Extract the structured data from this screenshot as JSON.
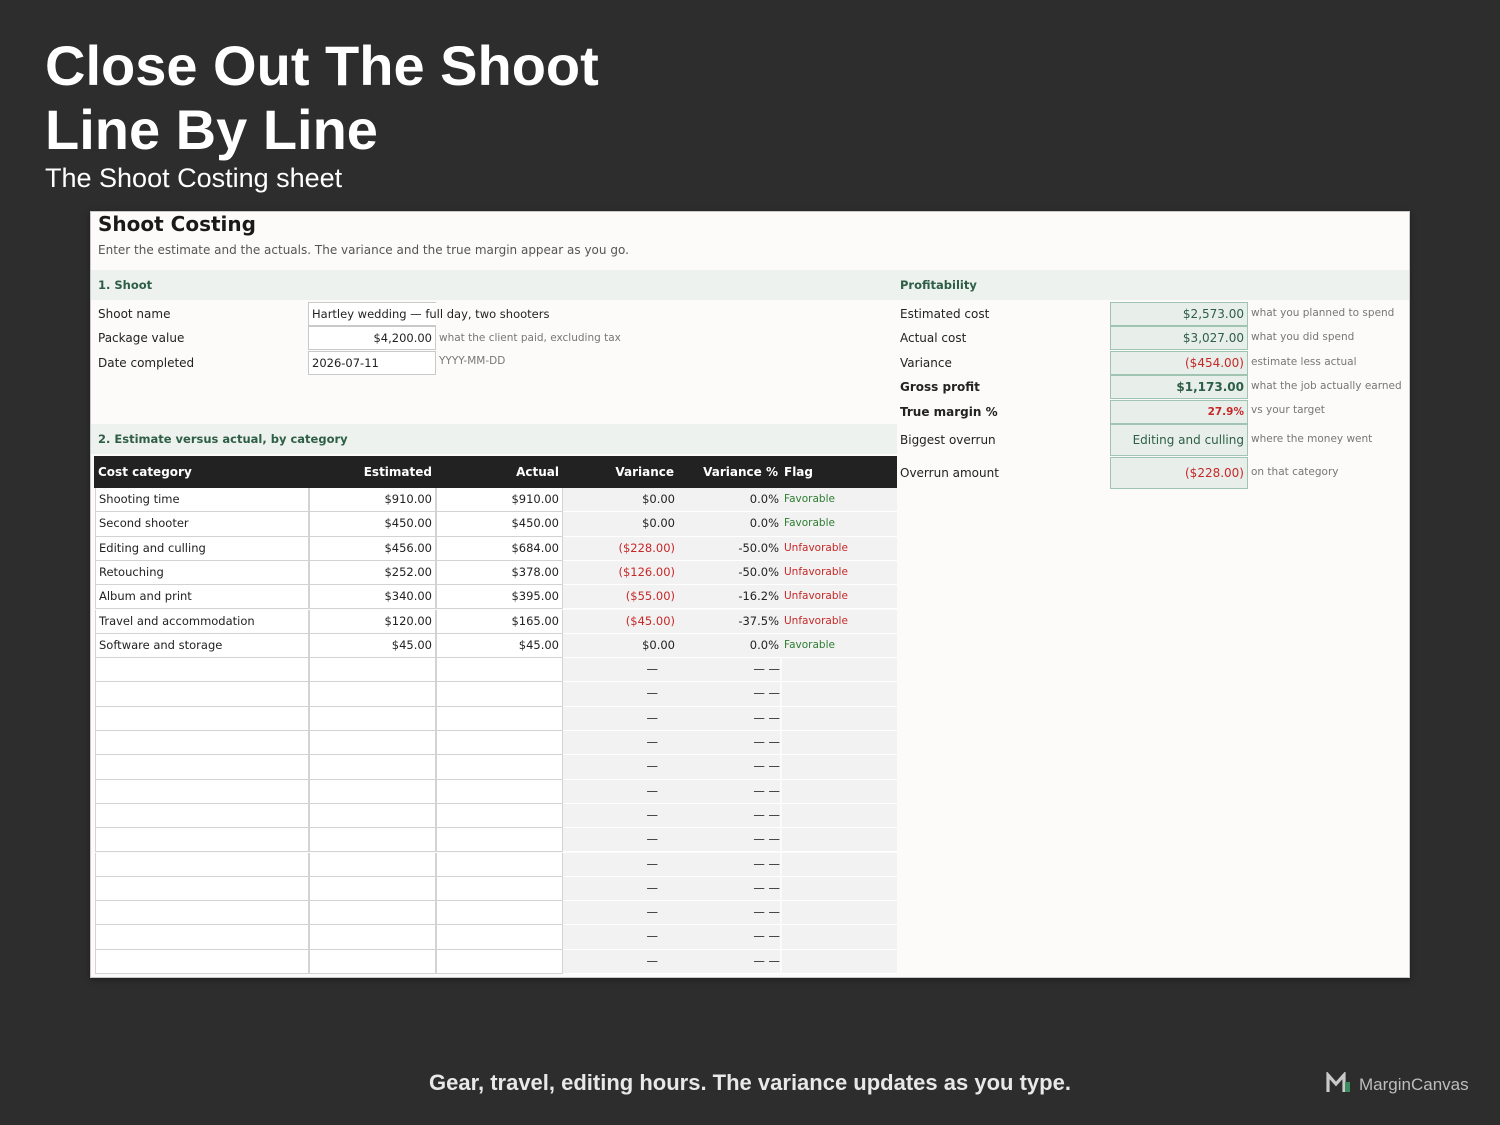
{
  "hero": {
    "title_line1": "Close Out The Shoot",
    "title_line2": "Line By Line",
    "subtitle": "The Shoot Costing sheet"
  },
  "sheet": {
    "title": "Shoot Costing",
    "description": "Enter the estimate and the actuals. The variance and the true margin appear as you go."
  },
  "section1": {
    "header": "1. Shoot",
    "fields": [
      {
        "label": "Shoot name",
        "value": "Hartley wedding — full day, two shooters",
        "hint": ""
      },
      {
        "label": "Package value",
        "value": "$4,200.00",
        "hint": "what the client paid, excluding tax"
      },
      {
        "label": "Date completed",
        "value": "2026-07-11",
        "hint": "YYYY-MM-DD"
      }
    ]
  },
  "section2": {
    "header": "2. Estimate versus actual, by category",
    "columns": [
      "Cost category",
      "Estimated",
      "Actual",
      "Variance",
      "Variance %",
      "Flag"
    ],
    "rows": [
      {
        "category": "Shooting time",
        "estimated": "$910.00",
        "actual": "$910.00",
        "variance": "$0.00",
        "pct": "0.0%",
        "flag": "Favorable"
      },
      {
        "category": "Second shooter",
        "estimated": "$450.00",
        "actual": "$450.00",
        "variance": "$0.00",
        "pct": "0.0%",
        "flag": "Favorable"
      },
      {
        "category": "Editing and culling",
        "estimated": "$456.00",
        "actual": "$684.00",
        "variance": "($228.00)",
        "pct": "-50.0%",
        "flag": "Unfavorable"
      },
      {
        "category": "Retouching",
        "estimated": "$252.00",
        "actual": "$378.00",
        "variance": "($126.00)",
        "pct": "-50.0%",
        "flag": "Unfavorable"
      },
      {
        "category": "Album and print",
        "estimated": "$340.00",
        "actual": "$395.00",
        "variance": "($55.00)",
        "pct": "-16.2%",
        "flag": "Unfavorable"
      },
      {
        "category": "Travel and accommodation",
        "estimated": "$120.00",
        "actual": "$165.00",
        "variance": "($45.00)",
        "pct": "-37.5%",
        "flag": "Unfavorable"
      },
      {
        "category": "Software and storage",
        "estimated": "$45.00",
        "actual": "$45.00",
        "variance": "$0.00",
        "pct": "0.0%",
        "flag": "Favorable"
      }
    ],
    "empty_rows": 13,
    "empty_dash": "—",
    "empty_pct": "— —"
  },
  "profitability": {
    "header": "Profitability",
    "items": [
      {
        "label": "Estimated cost",
        "value": "$2,573.00",
        "hint": "what you planned to spend"
      },
      {
        "label": "Actual cost",
        "value": "$3,027.00",
        "hint": "what you did spend"
      },
      {
        "label": "Variance",
        "value": "($454.00)",
        "hint": "estimate less actual"
      },
      {
        "label": "Gross profit",
        "value": "$1,173.00",
        "hint": "what the job actually earned"
      },
      {
        "label": "True margin %",
        "value": "27.9%",
        "hint": "vs your target"
      },
      {
        "label": "Biggest overrun",
        "value": "Editing and culling",
        "hint": "where the money went"
      },
      {
        "label": "Overrun amount",
        "value": "($228.00)",
        "hint": "on that category"
      }
    ]
  },
  "footer": {
    "tagline": "Gear, travel, editing hours. The variance updates as you type.",
    "brand": "MarginCanvas",
    "brand_icon": "margincanvas-logo-icon"
  },
  "colors": {
    "background": "#2d2d2d",
    "accent_green": "#2e5e46",
    "negative_red": "#c62828",
    "favorable_green": "#2e7d32"
  }
}
